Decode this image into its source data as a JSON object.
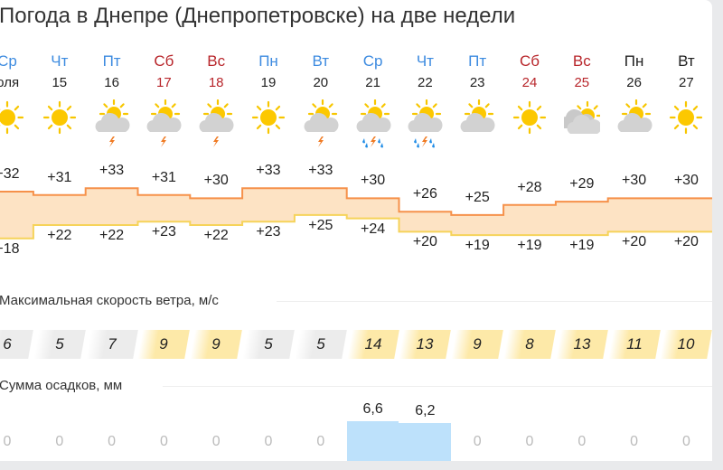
{
  "title": "Погода в Днепре (Днепропетровске) на две недели",
  "month_label": "июля",
  "days": [
    {
      "dow": "Ср",
      "date": "июля",
      "kind": "weekday",
      "icon": "sun",
      "precip_icon": "",
      "high": "+32",
      "low": "+18",
      "high_v": 32,
      "low_v": 18,
      "wind": "6",
      "wind_v": 6,
      "precip": "0",
      "precip_v": 0
    },
    {
      "dow": "Чт",
      "date": "15",
      "kind": "weekday",
      "icon": "sun",
      "precip_icon": "",
      "high": "+31",
      "low": "+22",
      "high_v": 31,
      "low_v": 22,
      "wind": "5",
      "wind_v": 5,
      "precip": "0",
      "precip_v": 0
    },
    {
      "dow": "Пт",
      "date": "16",
      "kind": "weekday",
      "icon": "sun-cloud",
      "precip_icon": "thunder",
      "high": "+33",
      "low": "+22",
      "high_v": 33,
      "low_v": 22,
      "wind": "7",
      "wind_v": 7,
      "precip": "0",
      "precip_v": 0
    },
    {
      "dow": "Сб",
      "date": "17",
      "kind": "weekend",
      "icon": "sun-cloud",
      "precip_icon": "thunder",
      "high": "+31",
      "low": "+23",
      "high_v": 31,
      "low_v": 23,
      "wind": "9",
      "wind_v": 9,
      "precip": "0",
      "precip_v": 0
    },
    {
      "dow": "Вс",
      "date": "18",
      "kind": "weekend",
      "icon": "sun-cloud",
      "precip_icon": "thunder",
      "high": "+30",
      "low": "+22",
      "high_v": 30,
      "low_v": 22,
      "wind": "9",
      "wind_v": 9,
      "precip": "0",
      "precip_v": 0
    },
    {
      "dow": "Пн",
      "date": "19",
      "kind": "weekday",
      "icon": "sun",
      "precip_icon": "",
      "high": "+33",
      "low": "+23",
      "high_v": 33,
      "low_v": 23,
      "wind": "5",
      "wind_v": 5,
      "precip": "0",
      "precip_v": 0
    },
    {
      "dow": "Вт",
      "date": "20",
      "kind": "weekday",
      "icon": "sun-cloud",
      "precip_icon": "thunder",
      "high": "+33",
      "low": "+25",
      "high_v": 33,
      "low_v": 25,
      "wind": "5",
      "wind_v": 5,
      "precip": "0",
      "precip_v": 0
    },
    {
      "dow": "Ср",
      "date": "21",
      "kind": "weekday",
      "icon": "sun-cloud",
      "precip_icon": "rain-thunder",
      "high": "+30",
      "low": "+24",
      "high_v": 30,
      "low_v": 24,
      "wind": "14",
      "wind_v": 14,
      "precip": "6,6",
      "precip_v": 6.6
    },
    {
      "dow": "Чт",
      "date": "22",
      "kind": "weekday",
      "icon": "sun-cloud",
      "precip_icon": "rain-thunder",
      "high": "+26",
      "low": "+20",
      "high_v": 26,
      "low_v": 20,
      "wind": "13",
      "wind_v": 13,
      "precip": "6,2",
      "precip_v": 6.2
    },
    {
      "dow": "Пт",
      "date": "23",
      "kind": "weekday",
      "icon": "sun-cloud",
      "precip_icon": "",
      "high": "+25",
      "low": "+19",
      "high_v": 25,
      "low_v": 19,
      "wind": "9",
      "wind_v": 9,
      "precip": "0",
      "precip_v": 0
    },
    {
      "dow": "Сб",
      "date": "24",
      "kind": "weekend",
      "icon": "sun",
      "precip_icon": "",
      "high": "+28",
      "low": "+19",
      "high_v": 28,
      "low_v": 19,
      "wind": "8",
      "wind_v": 8,
      "precip": "0",
      "precip_v": 0
    },
    {
      "dow": "Вс",
      "date": "25",
      "kind": "weekend",
      "icon": "cloudy-sun",
      "precip_icon": "",
      "high": "+29",
      "low": "+19",
      "high_v": 29,
      "low_v": 19,
      "wind": "13",
      "wind_v": 13,
      "precip": "0",
      "precip_v": 0
    },
    {
      "dow": "Пн",
      "date": "26",
      "kind": "next-week",
      "icon": "sun-cloud",
      "precip_icon": "",
      "high": "+30",
      "low": "+20",
      "high_v": 30,
      "low_v": 20,
      "wind": "11",
      "wind_v": 11,
      "precip": "0",
      "precip_v": 0
    },
    {
      "dow": "Вт",
      "date": "27",
      "kind": "next-week",
      "icon": "sun",
      "precip_icon": "",
      "high": "+30",
      "low": "+20",
      "high_v": 30,
      "low_v": 20,
      "wind": "10",
      "wind_v": 10,
      "precip": "0",
      "precip_v": 0
    }
  ],
  "wind_section": {
    "label": "Максимальная скорость ветра, м/с"
  },
  "precip_section": {
    "label": "Сумма осадков, мм"
  },
  "colors": {
    "weekday": "#3d8be0",
    "weekend": "#b8262b",
    "next_week": "#222222",
    "high_line": "#f6914a",
    "low_line": "#f6d35a",
    "band": "#fde3c4",
    "wind_calm": "#ececec",
    "wind_strong": "#fde9a8",
    "precip_bar": "#bde1fb"
  }
}
